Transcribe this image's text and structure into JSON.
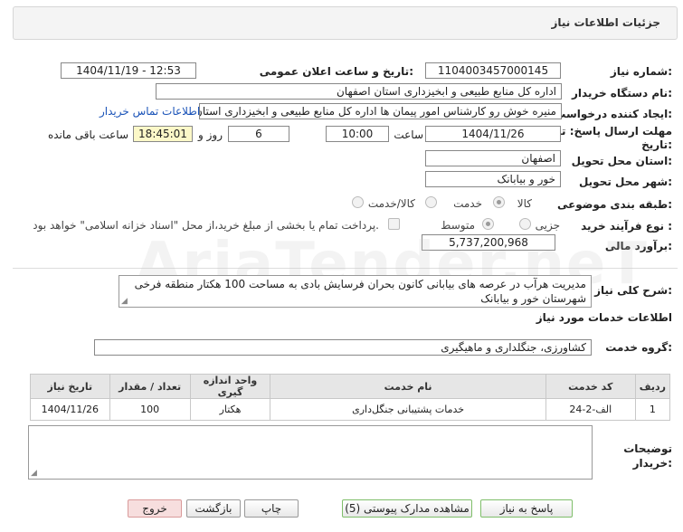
{
  "header": {
    "title": "جزئیات اطلاعات نیاز"
  },
  "form": {
    "need_number_label": "شماره نیاز:",
    "need_number": "1104003457000145",
    "announce_label": "تاریخ و ساعت اعلان عمومی:",
    "announce_value": "1404/11/19 - 12:53",
    "buyer_org_label": "نام دستگاه خریدار:",
    "buyer_org": "اداره کل منابع طبیعی و ابخیزداری استان اصفهان",
    "creator_label": "ایجاد کننده درخواست:",
    "creator": "منیره خوش رو کارشناس امور پیمان ها اداره کل منابع طبیعی و ابخیزداری استان اصفهان",
    "contact_link": "اطلاعات تماس خریدار",
    "deadline_label": "مهلت ارسال پاسخ: تا تاریخ:",
    "deadline_date": "1404/11/26",
    "time_label": "ساعت",
    "deadline_time": "10:00",
    "days_value": "6",
    "days_label": "روز و",
    "remaining_time": "18:45:01",
    "remaining_label": "ساعت باقی مانده",
    "province_label": "استان محل تحویل:",
    "province": "اصفهان",
    "city_label": "شهر محل تحویل:",
    "city": "خور و بیابانک",
    "category_label": "طبقه بندی موضوعی:",
    "category_options": [
      "کالا",
      "خدمت",
      "کالا/خدمت"
    ],
    "purchase_label": "نوع فرآیند خرید :",
    "purchase_options": [
      "جزیی",
      "متوسط"
    ],
    "payment_note": "پرداخت تمام یا بخشی از مبلغ خرید،از محل \"اسناد خزانه اسلامی\" خواهد بود.",
    "budget_label": "برآورد مالی:",
    "budget": "5,737,200,968"
  },
  "description": {
    "label": "شرح کلی نیاز:",
    "text": "مدیریت هرآب در عرصه های بیابانی کانون بحران فرسایش بادی به مساحت 100 هکتار منطقه فرخی شهرستان خور و بیابانک"
  },
  "services": {
    "section_title": "اطلاعات خدمات مورد نیاز",
    "group_label": "گروه خدمت:",
    "group_value": "کشاورزی، جنگلداری و ماهیگیری",
    "columns": [
      "ردیف",
      "کد خدمت",
      "نام خدمت",
      "واحد اندازه گیری",
      "تعداد / مقدار",
      "تاریخ نیاز"
    ],
    "rows": [
      [
        "1",
        "الف-2-24",
        "خدمات پشتیبانی جنگل‌داری",
        "هکتار",
        "100",
        "1404/11/26"
      ]
    ]
  },
  "buyer_notes": {
    "label": "توضیحات خریدار:"
  },
  "buttons": {
    "reply": "پاسخ به نیاز",
    "docs": "مشاهده مدارک پیوستی (5)",
    "print": "چاپ",
    "back": "بازگشت",
    "exit": "خروج"
  },
  "colors": {
    "link": "#1a53b8",
    "highlight": "#fcf8c8",
    "exit_button": "#f7dede"
  }
}
